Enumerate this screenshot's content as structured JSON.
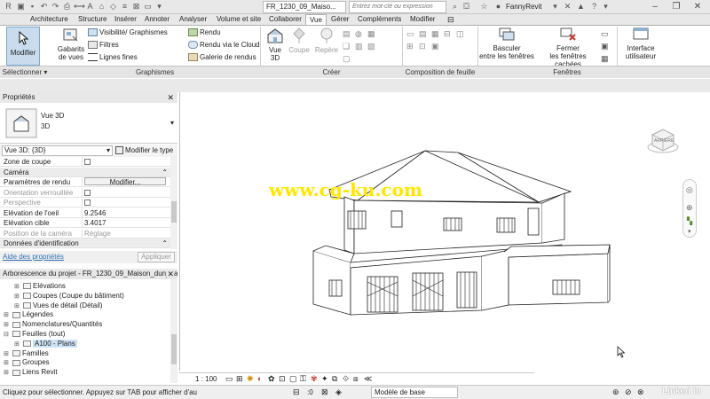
{
  "titlebar": {
    "document_title": "FR_1230_09_Maiso...",
    "search_placeholder": "Entrez mot-clé ou expression",
    "user_name": "FannyRevit"
  },
  "tabs": [
    "Architecture",
    "Structure",
    "Insérer",
    "Annoter",
    "Analyser",
    "Volume et site",
    "Collaborer",
    "Vue",
    "Gérer",
    "Compléments",
    "Modifier"
  ],
  "active_tab": "Vue",
  "ribbon": {
    "modifier": "Modifier",
    "gabarits": "Gabarits\nde vues",
    "visibilite": "Visibilité/ Graphismes",
    "filtres": "Filtres",
    "lignes_fines": "Lignes fines",
    "rendu": "Rendu",
    "rendu_cloud": "Rendu  via le Cloud",
    "galerie": "Galerie de rendus",
    "vue_3d": "Vue\n3D",
    "coupe": "Coupe",
    "repere": "Repère",
    "basculer": "Basculer\nentre les fenêtres",
    "fermer": "Fermer\nles fenêtres cachées",
    "interface": "Interface\nutilisateur",
    "panel_labels": {
      "selectionner": "Sélectionner ▾",
      "graphismes": "Graphismes",
      "creer": "Créer",
      "composition": "Composition de feuille",
      "fenetres": "Fenêtres"
    }
  },
  "properties": {
    "title": "Propriétés",
    "type_name": "Vue 3D",
    "type_sub": "3D",
    "selector": "Vue 3D: {3D}",
    "edit_type": "Modifier le type",
    "rows": [
      {
        "key": "Zone de coupe",
        "value": "",
        "checkbox": true
      },
      {
        "key": "Caméra",
        "value": "",
        "section": true
      },
      {
        "key": "Paramètres de rendu",
        "value": "Modifier...",
        "button": true
      },
      {
        "key": "Orientation verrouillée",
        "value": "",
        "checkbox": true,
        "grey": true
      },
      {
        "key": "Perspective",
        "value": "",
        "checkbox": true,
        "grey": true
      },
      {
        "key": "Elévation de l'oeil",
        "value": "9.2546"
      },
      {
        "key": "Elévation cible",
        "value": "3.4017"
      },
      {
        "key": "Position de la caméra",
        "value": "Réglage",
        "grey": true
      },
      {
        "key": "Données d'identification",
        "value": "",
        "section": true
      }
    ],
    "help_link": "Aide des propriétés",
    "apply": "Appliquer"
  },
  "browser": {
    "title": "Arborescence du projet - FR_1230_09_Maison_dun_parti...",
    "items": [
      {
        "label": "Elévations",
        "indent": 2
      },
      {
        "label": "Coupes (Coupe du bâtiment)",
        "indent": 2
      },
      {
        "label": "Vues de détail (Détail)",
        "indent": 2
      },
      {
        "label": "Légendes",
        "indent": 1
      },
      {
        "label": "Nomenclatures/Quantités",
        "indent": 1
      },
      {
        "label": "Feuilles (tout)",
        "indent": 1
      },
      {
        "label": "A100 - Plans",
        "indent": 2,
        "selected": true
      },
      {
        "label": "Familles",
        "indent": 1
      },
      {
        "label": "Groupes",
        "indent": 1
      },
      {
        "label": "Liens Revit",
        "indent": 1
      }
    ]
  },
  "viewport": {
    "scale": "1 : 100",
    "watermark": "www.cg-ku.com",
    "viewcube_label": "ARRIÈRE",
    "model_name": "Modèle de base"
  },
  "status": {
    "message": "Cliquez pour sélectionner. Appuyez sur TAB pour afficher d'au",
    "zero": ":0",
    "linkedin": "Linked in"
  },
  "colors": {
    "accent": "#2f6fb3",
    "watermark": "#ffe600"
  }
}
